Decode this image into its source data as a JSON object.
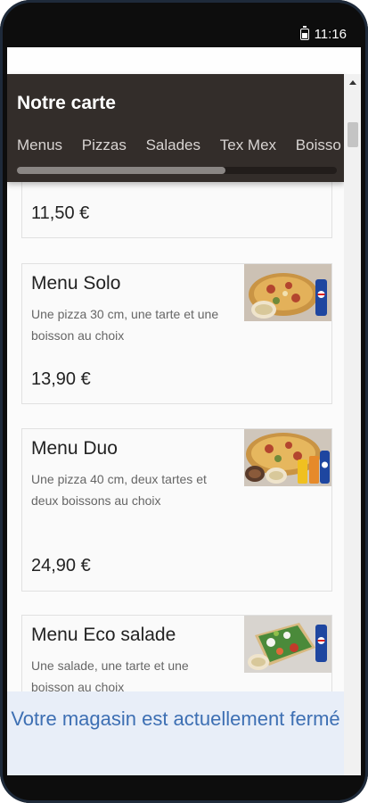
{
  "status_bar": {
    "time": "11:16",
    "battery_icon": "battery-icon"
  },
  "header": {
    "title": "Notre carte",
    "tabs": [
      "Menus",
      "Pizzas",
      "Salades",
      "Tex Mex",
      "Boisso"
    ]
  },
  "items": [
    {
      "price": "11,50 €"
    },
    {
      "name": "Menu Solo",
      "description": "Une pizza 30 cm, une tarte et une boisson au choix",
      "price": "13,90 €"
    },
    {
      "name": "Menu Duo",
      "description": "Une pizza 40 cm, deux tartes et deux boissons au choix",
      "price": "24,90 €"
    },
    {
      "name": "Menu Eco salade",
      "description": "Une salade, une tarte et une boisson au choix"
    }
  ],
  "banner": {
    "text": "Votre magasin est actuellement fermé"
  },
  "colors": {
    "header_bg": "#332d2a",
    "banner_bg": "#e8eef8",
    "banner_text": "#3d6fb3"
  }
}
